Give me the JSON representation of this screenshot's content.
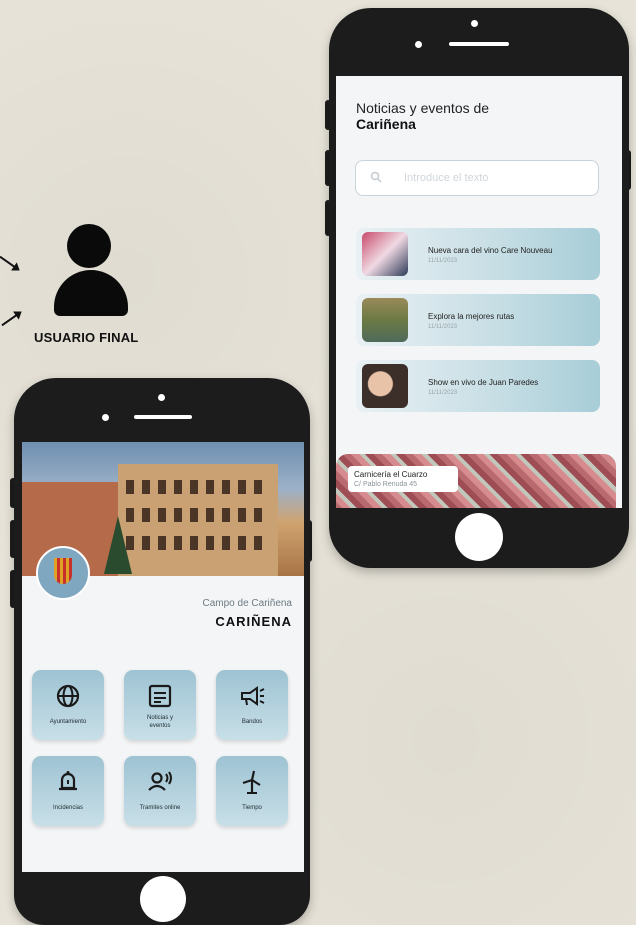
{
  "user": {
    "label": "USUARIO FINAL"
  },
  "news_screen": {
    "title": "Noticias y eventos de",
    "city": "Cariñena",
    "search_placeholder": "Introduce el texto",
    "items": [
      {
        "title": "Nueva cara del vino Care Nouveau",
        "date": "11/11/2023"
      },
      {
        "title": "Explora la mejores rutas",
        "date": "11/11/2023"
      },
      {
        "title": "Show en vivo de Juan Paredes",
        "date": "11/11/2023"
      }
    ],
    "ad": {
      "name": "Carnicería el Cuarzo",
      "address": "C/ Pablo Renuda 45"
    }
  },
  "home_screen": {
    "region": "Campo de Cariñena",
    "city": "CARIÑENA",
    "tiles": [
      {
        "label": "Ayuntamiento",
        "icon": "globe-icon"
      },
      {
        "label": "Noticias y eventos",
        "icon": "news-icon"
      },
      {
        "label": "Bandos",
        "icon": "megaphone-icon"
      },
      {
        "label": "Incidencias",
        "icon": "bell-icon"
      },
      {
        "label": "Tramites online",
        "icon": "person-voice-icon"
      },
      {
        "label": "Tiempo",
        "icon": "windmill-icon"
      }
    ]
  }
}
